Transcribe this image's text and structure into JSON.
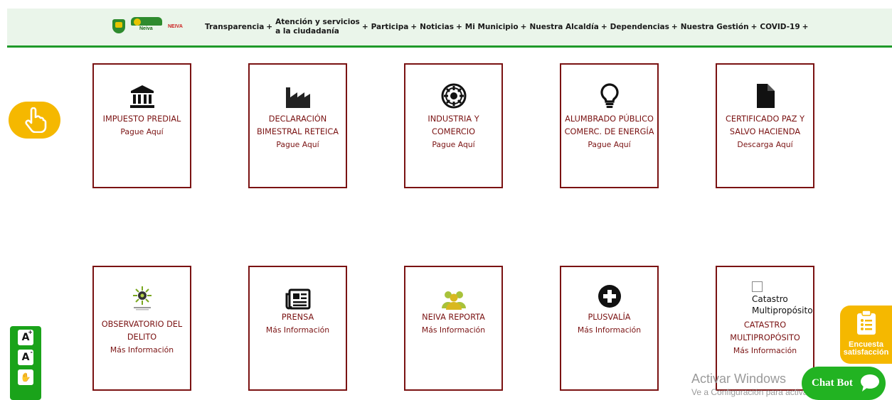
{
  "header": {
    "logos": {
      "small": "NEIVA"
    },
    "nav": [
      {
        "label": "Transparencia"
      },
      {
        "line1": "Atención y servicios",
        "line2": "a la ciudadanía"
      },
      {
        "label": "Participa"
      },
      {
        "label": "Noticias"
      },
      {
        "label": "Mi Municipio"
      },
      {
        "label": "Nuestra Alcaldía"
      },
      {
        "label": "Dependencias"
      },
      {
        "label": "Nuestra Gestión"
      },
      {
        "label": "COVID-19"
      }
    ],
    "plus": "+",
    "accent": "#1f9a2a"
  },
  "cards_row1": [
    {
      "icon": "bank-icon",
      "title": "IMPUESTO PREDIAL",
      "sub": "Pague Aquí"
    },
    {
      "icon": "factory-icon",
      "title": "DECLARACIÓN BIMESTRAL RETEICA",
      "sub": "Pague Aquí"
    },
    {
      "icon": "empire-icon",
      "title": "INDUSTRIA Y COMERCIO",
      "sub": "Pague Aquí"
    },
    {
      "icon": "lightbulb-icon",
      "title": "ALUMBRADO PÚBLICO COMERC. DE ENERGÍA",
      "sub": "Pague Aquí"
    },
    {
      "icon": "file-icon",
      "title": "CERTIFICADO PAZ Y SALVO HACIENDA",
      "sub": "Descarga Aquí"
    }
  ],
  "cards_row2": [
    {
      "icon": "observatorio-logo-icon",
      "title": "OBSERVATORIO DEL DELITO",
      "sub": "Más Información"
    },
    {
      "icon": "newspaper-icon",
      "title": "PRENSA",
      "sub": "Más Información"
    },
    {
      "icon": "users-icon",
      "title": "NEIVA REPORTA",
      "sub": "Más Información"
    },
    {
      "icon": "plus-circle-icon",
      "title": "PLUSVALÍA",
      "sub": "Más Información"
    },
    {
      "icon": "broken-image-icon",
      "alt": "Catastro Multipropósito",
      "title": "CATASTRO MULTIPROPÓSITO",
      "sub": "Más Información"
    }
  ],
  "accessibility": {
    "increase": "A",
    "decrease": "A",
    "sign": "✋"
  },
  "encuesta": {
    "label": "Encuesta satisfacción"
  },
  "chatbot": {
    "label": "Chat Bot"
  },
  "watermark": {
    "line1": "Activar Windows",
    "line2": "Ve a Configuración para activar Windows."
  },
  "colors": {
    "card_border": "#7a1212",
    "yellow": "#f5b800",
    "green": "#22b322"
  }
}
